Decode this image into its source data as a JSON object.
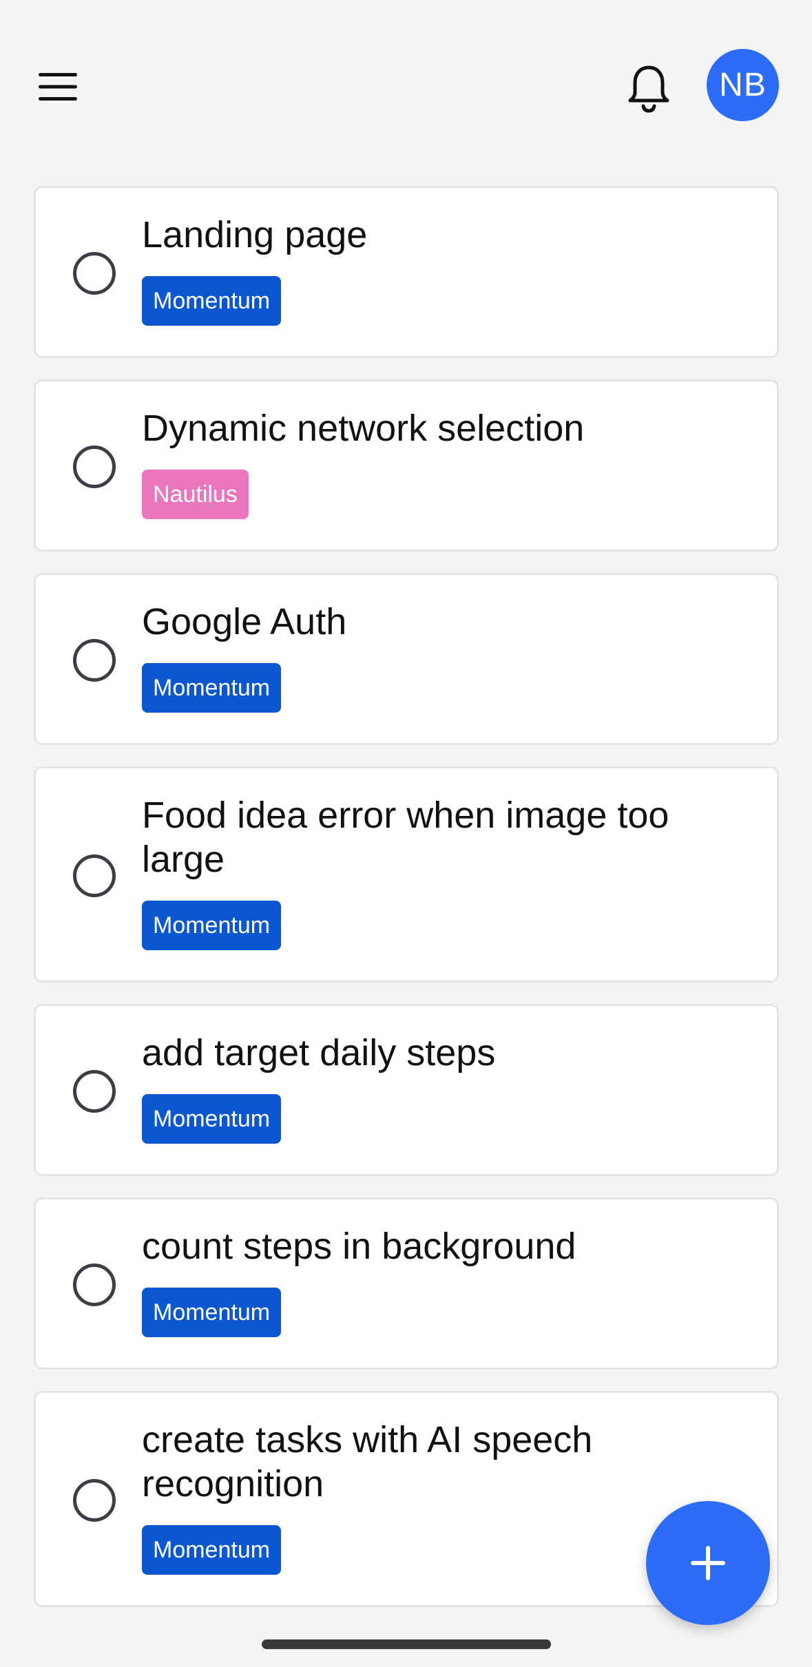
{
  "header": {
    "menu_icon": "hamburger-menu-icon",
    "notification_icon": "bell-icon",
    "avatar_initials": "NB",
    "accent_color": "#2c6cf6"
  },
  "tasks": [
    {
      "title": "Landing page",
      "project": "Momentum",
      "project_color": "#0a57d0"
    },
    {
      "title": "Dynamic network selection",
      "project": "Nautilus",
      "project_color": "#ea76bd"
    },
    {
      "title": "Google Auth",
      "project": "Momentum",
      "project_color": "#0a57d0"
    },
    {
      "title": "Food idea error when image too large",
      "project": "Momentum",
      "project_color": "#0a57d0"
    },
    {
      "title": "add target daily steps",
      "project": "Momentum",
      "project_color": "#0a57d0"
    },
    {
      "title": "count steps in background",
      "project": "Momentum",
      "project_color": "#0a57d0"
    },
    {
      "title": "create tasks with AI speech recognition",
      "project": "Momentum",
      "project_color": "#0a57d0"
    }
  ],
  "fab": {
    "icon": "plus-icon"
  }
}
